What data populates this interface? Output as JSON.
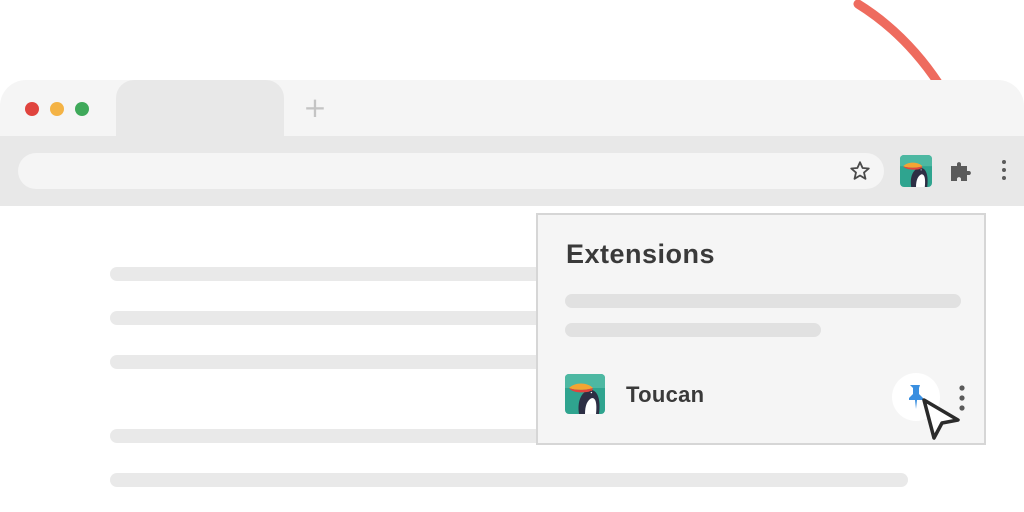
{
  "window": {
    "controls": [
      {
        "name": "close",
        "color": "#e0443e"
      },
      {
        "name": "minimize",
        "color": "#f4b345"
      },
      {
        "name": "maximize",
        "color": "#3fa95a"
      }
    ],
    "new_tab_label": "+"
  },
  "toolbar": {
    "bookmark_icon": "star-icon",
    "pinned_extension_icon": "toucan-icon",
    "extensions_icon": "puzzle-icon",
    "menu_icon": "kebab-menu-icon"
  },
  "extensions_popup": {
    "title": "Extensions",
    "items": [
      {
        "name": "Toucan",
        "icon": "toucan-icon",
        "pinned": true
      }
    ]
  },
  "colors": {
    "pin_blue": "#3a8fe0",
    "annotation_arrow": "#ee6b5e"
  }
}
